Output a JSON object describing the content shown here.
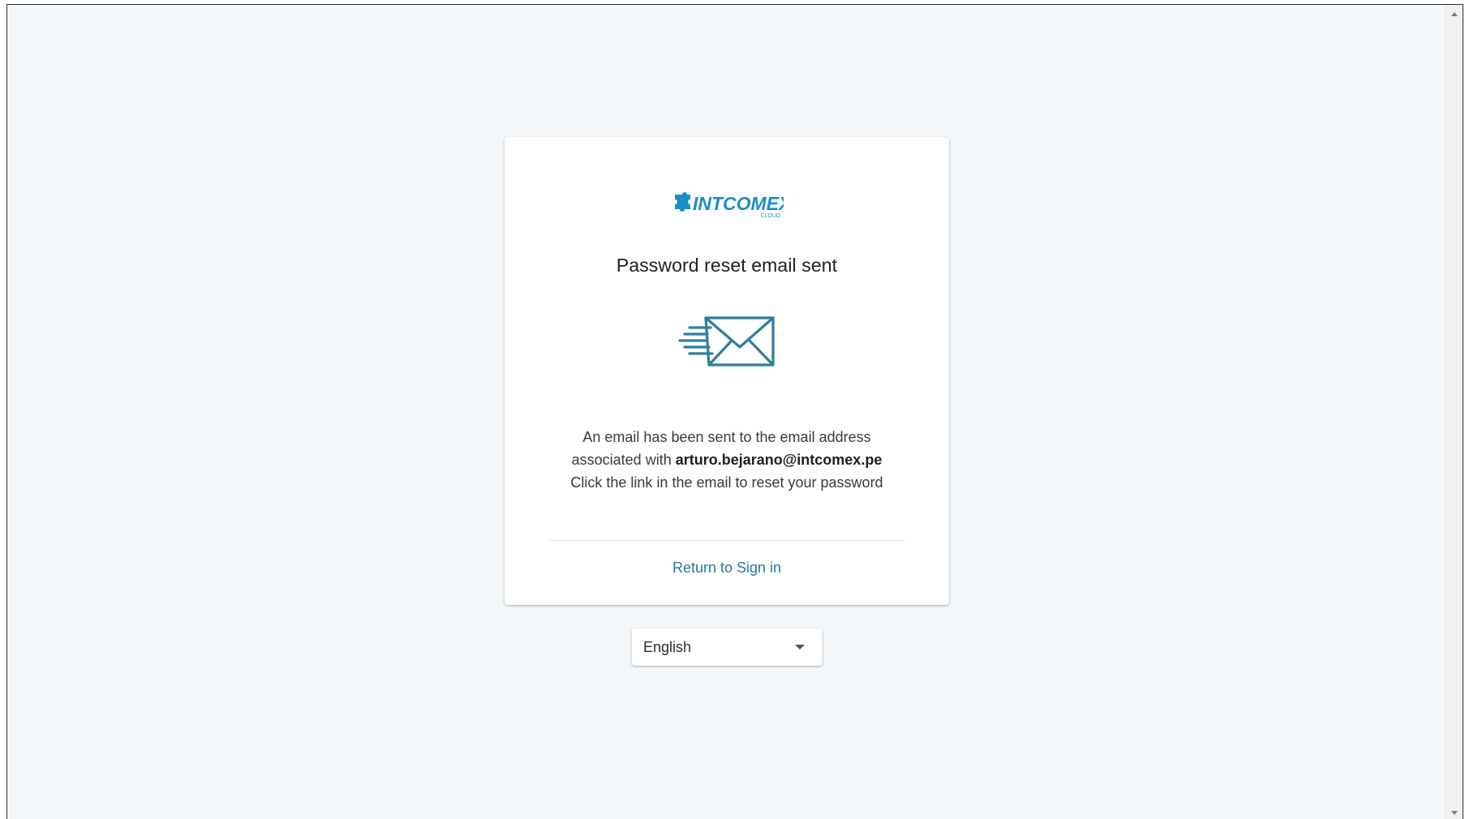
{
  "brand": {
    "logo_text": "INTCOMEX",
    "logo_subtext": "CLOUD",
    "color": "#1b8fc4"
  },
  "card": {
    "title": "Password reset email sent",
    "message_line1": "An email has been sent to the email address",
    "message_line2_prefix": "associated with ",
    "email": "arturo.bejarano@intcomex.pe",
    "message_line3": "Click the link in the email to reset your password",
    "return_link": "Return to Sign in",
    "icon": "envelope-sent-icon",
    "icon_color": "#2e7e9c"
  },
  "language": {
    "selected": "English"
  }
}
